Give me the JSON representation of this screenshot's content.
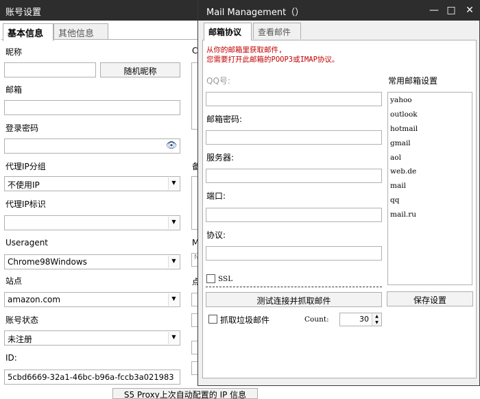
{
  "account_window": {
    "title": "账号设置",
    "tabs": [
      "基本信息",
      "其他信息"
    ],
    "nickname_label": "昵称",
    "nickname_value": "",
    "random_nickname_button": "随机昵称",
    "email_label": "邮箱",
    "email_value": "",
    "password_label": "登录密码",
    "password_value": "",
    "proxy_group_label": "代理IP分组",
    "proxy_group_value": "不使用IP",
    "proxy_tag_label": "代理IP标识",
    "proxy_tag_value": "",
    "useragent_label": "Useragent",
    "useragent_value": "Chrome98Windows",
    "site_label": "站点",
    "site_value": "amazon.com",
    "status_label": "账号状态",
    "status_value": "未注册",
    "id_label": "ID:",
    "id_value": "5cbd6669-32a1-46bc-b96a-fccb3a021983",
    "proxy_info_button": "S5 Proxy上次自动配置的 IP 信息",
    "partial_label_c": "C",
    "partial_label_bei": "备",
    "partial_label_m": "M",
    "partial_label_dian": "点",
    "partial_input_n": "N"
  },
  "mail_window": {
    "title": "Mail Management（）",
    "controls": {
      "minimize": "—",
      "maximize": "□",
      "close": "✕"
    },
    "tabs": [
      "邮箱协议",
      "查看邮件"
    ],
    "notice_line1": "从你的邮箱里获取邮件,",
    "notice_line2": "您需要打开此邮箱的POOP3或IMAP协议。",
    "qq_label": "QQ号:",
    "qq_value": "",
    "mail_password_label": "邮箱密码:",
    "mail_password_value": "",
    "server_label": "服务器:",
    "server_value": "",
    "port_label": "端口:",
    "port_value": "",
    "protocol_label": "协议:",
    "protocol_value": "",
    "ssl_label": "SSL",
    "ssl_checked": false,
    "test_button": "测试连接并抓取邮件",
    "junk_label": "抓取垃圾邮件",
    "junk_checked": false,
    "count_label": "Count:",
    "count_value": "30",
    "common_settings_label": "常用邮箱设置",
    "providers": [
      "yahoo",
      "outlook",
      "hotmail",
      "gmail",
      "aol",
      "web.de",
      "mail",
      "qq",
      "mail.ru"
    ],
    "save_button": "保存设置"
  }
}
